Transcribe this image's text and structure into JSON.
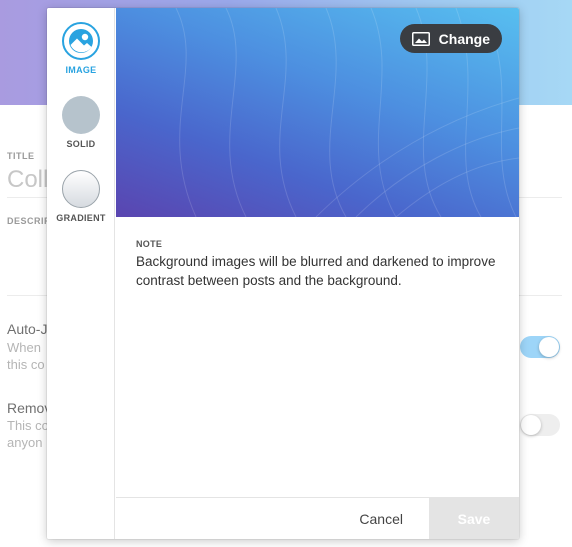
{
  "background_page": {
    "title_label": "TITLE",
    "title_value": "Coll",
    "description_label": "DESCRIP",
    "auto_join": {
      "title": "Auto-J",
      "subtitle_line1": "When",
      "subtitle_line2": "this co",
      "toggle_on": true
    },
    "remove": {
      "title": "Remov",
      "subtitle_line1": "This co",
      "subtitle_line2": "anyon",
      "toggle_on": false
    }
  },
  "popup": {
    "options": [
      {
        "label": "IMAGE",
        "active": true
      },
      {
        "label": "SOLID",
        "active": false
      },
      {
        "label": "GRADIENT",
        "active": false
      }
    ],
    "change_button_label": "Change",
    "note_label": "NOTE",
    "note_text": "Background images will be blurred and darkened to improve contrast between posts and the background.",
    "cancel_label": "Cancel",
    "save_label": "Save"
  },
  "colors": {
    "accent": "#29a3e0",
    "toggle_on": "#9dd5f8",
    "save_disabled": "#e4e4e4",
    "change_button_bg": "#3a3d42"
  },
  "icons": {
    "image_option": "image-icon",
    "change_button": "picture-icon"
  }
}
